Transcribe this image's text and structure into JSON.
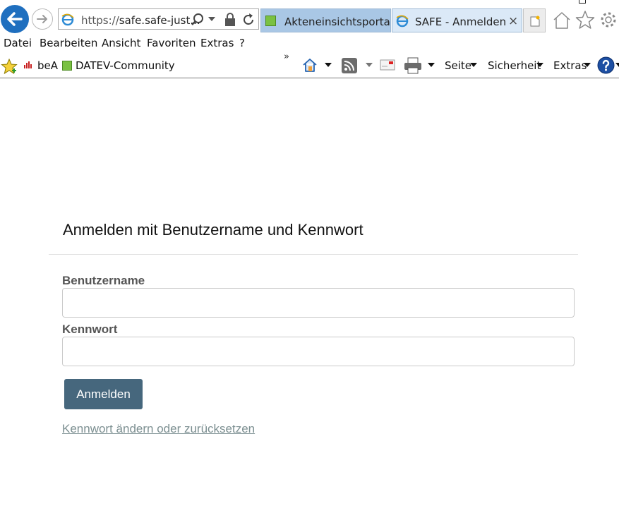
{
  "browser": {
    "url": "https://safe.safe-just...",
    "url_prefix": "https://",
    "url_host": "safe.safe-just...",
    "tabs": [
      {
        "label": "Akteneinsichtsportal ..."
      },
      {
        "label": "SAFE - Anmelden",
        "close": "×"
      }
    ],
    "menu": [
      "Datei",
      "Bearbeiten",
      "Ansicht",
      "Favoriten",
      "Extras",
      "?"
    ],
    "favorites": [
      {
        "label": "beA"
      },
      {
        "label": "DATEV-Community"
      }
    ],
    "toolbar": {
      "overflow": "»",
      "page": "Seite",
      "security": "Sicherheit",
      "tools": "Extras"
    }
  },
  "login": {
    "heading": "Anmelden mit Benutzername und Kennwort",
    "username_label": "Benutzername",
    "username_value": "",
    "password_label": "Kennwort",
    "password_value": "",
    "submit_label": "Anmelden",
    "reset_link": "Kennwort ändern oder zurücksetzen"
  },
  "colors": {
    "button_bg": "#46677d",
    "link": "#7c8f91",
    "ie_blue": "#1f6fbf"
  }
}
